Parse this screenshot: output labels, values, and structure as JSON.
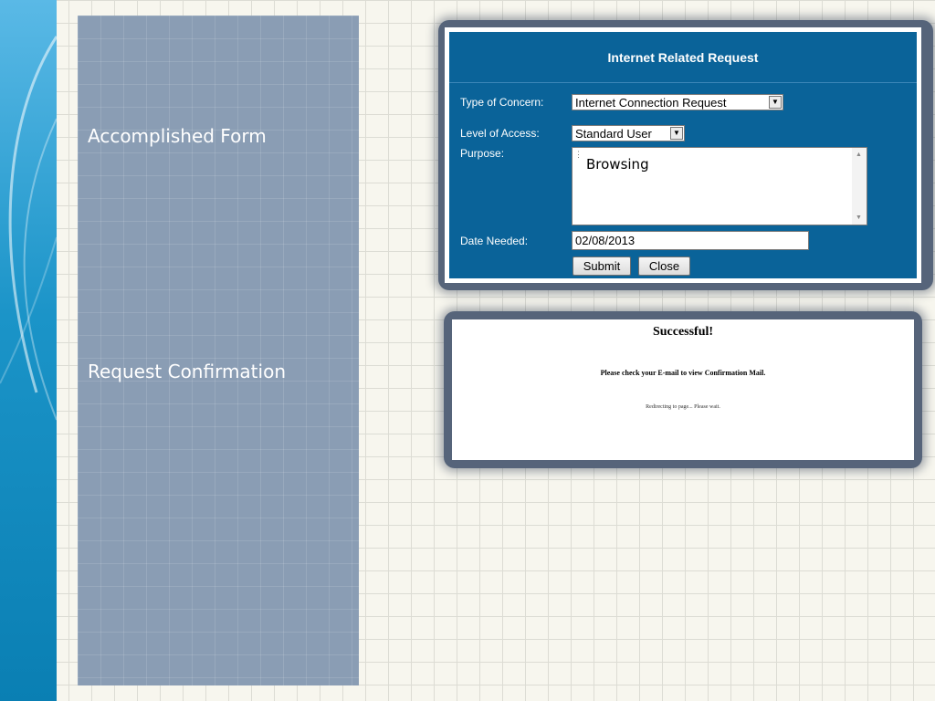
{
  "slide": {
    "labels": {
      "accomplished": "Accomplished Form",
      "confirmation": "Request Confirmation"
    }
  },
  "form": {
    "title": "Internet Related Request",
    "type_label": "Type of Concern:",
    "type_value": "Internet Connection Request",
    "access_label": "Level of Access:",
    "access_value": "Standard User",
    "purpose_label": "Purpose:",
    "purpose_value": "Browsing",
    "date_label": "Date Needed:",
    "date_value": "02/08/2013",
    "submit_label": "Submit",
    "close_label": "Close"
  },
  "confirmation": {
    "title": "Successful!",
    "message": "Please check your E-mail to view Confirmation Mail.",
    "sub": "Redirecting to page... Please wait."
  },
  "icons": {
    "dropdown": "chevron-down-icon",
    "scroll_up": "scroll-up-icon",
    "scroll_down": "scroll-down-icon",
    "resize": "resize-grip-icon"
  },
  "colors": {
    "form_bg": "#0a6399",
    "panel_bg": "#8a9db4",
    "accent_strip": "#1b94c8"
  }
}
